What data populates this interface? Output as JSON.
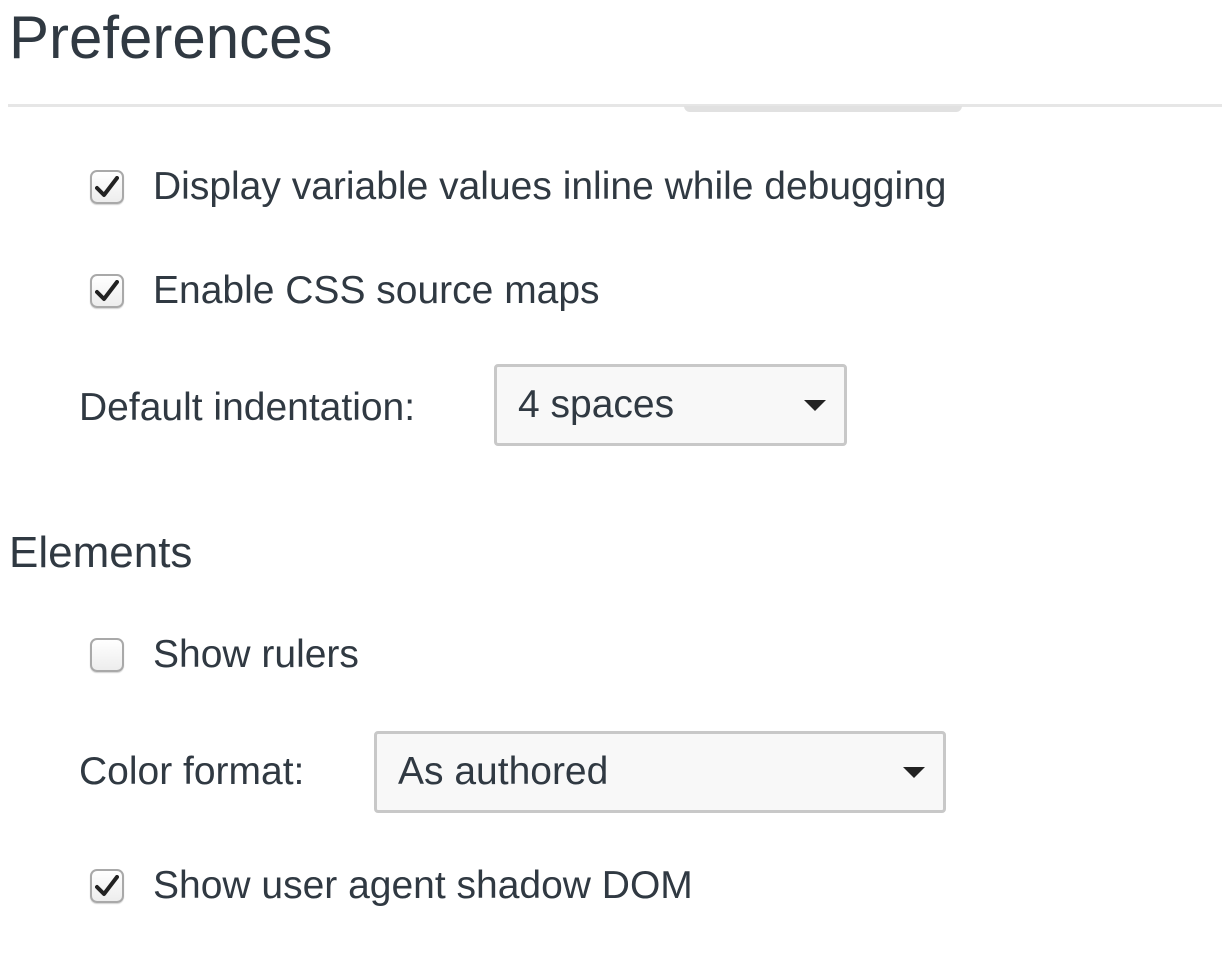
{
  "header": {
    "title": "Preferences"
  },
  "sources": {
    "inline_values": {
      "label": "Display variable values inline while debugging",
      "checked": true
    },
    "css_source_maps": {
      "label": "Enable CSS source maps",
      "checked": true
    },
    "indentation": {
      "label": "Default indentation:",
      "value": "4 spaces"
    }
  },
  "elements": {
    "title": "Elements",
    "show_rulers": {
      "label": "Show rulers",
      "checked": false
    },
    "color_format": {
      "label": "Color format:",
      "value": "As authored"
    },
    "shadow_dom": {
      "label": "Show user agent shadow DOM",
      "checked": true
    }
  },
  "icons": {
    "checkmark": "checkmark-icon",
    "dropdown": "triangle-down-icon"
  }
}
